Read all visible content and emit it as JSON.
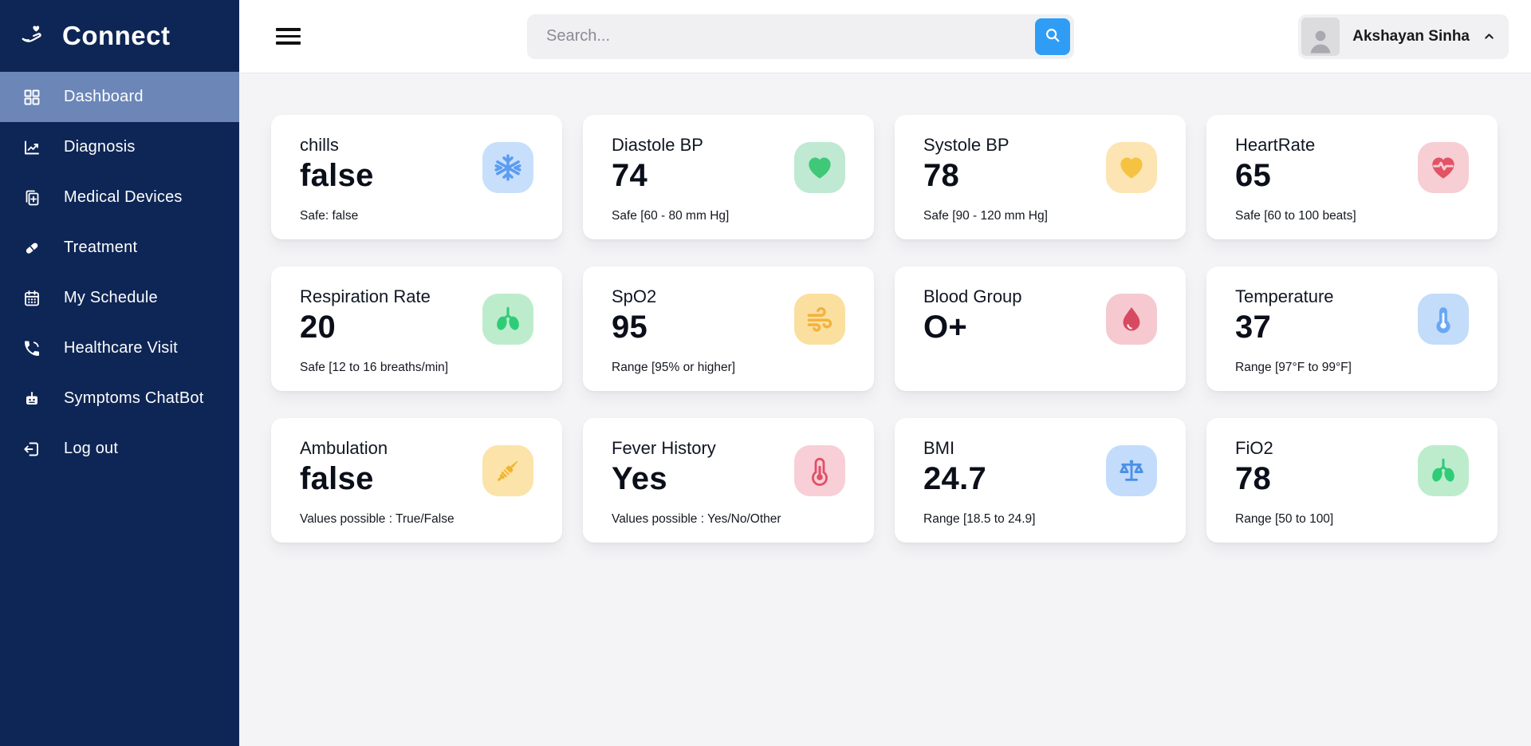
{
  "app": {
    "name": "Connect"
  },
  "theme": {
    "sidebar_bg": "#0e2655",
    "sidebar_active_bg": "#6b86b7",
    "page_bg": "#f4f4f6",
    "topbar_bg": "#ffffff",
    "search_button_blue": "#2f9df5"
  },
  "sidebar": {
    "items": [
      {
        "label": "Dashboard",
        "icon": "dashboard-grid-icon",
        "active": true
      },
      {
        "label": "Diagnosis",
        "icon": "chart-line-icon",
        "active": false
      },
      {
        "label": "Medical Devices",
        "icon": "medical-devices-icon",
        "active": false
      },
      {
        "label": "Treatment",
        "icon": "pill-icon",
        "active": false
      },
      {
        "label": "My Schedule",
        "icon": "calendar-icon",
        "active": false
      },
      {
        "label": "Healthcare Visit",
        "icon": "phone-icon",
        "active": false
      },
      {
        "label": "Symptoms ChatBot",
        "icon": "robot-icon",
        "active": false
      },
      {
        "label": "Log out",
        "icon": "logout-icon",
        "active": false
      }
    ]
  },
  "topbar": {
    "search": {
      "placeholder": "Search...",
      "button_icon": "magnifier-icon"
    },
    "user": {
      "name": "Akshayan Sinha",
      "avatar": "person-placeholder",
      "chevron": "chevron-up-icon"
    }
  },
  "cards": [
    {
      "title": "chills",
      "value": "false",
      "note": "Safe: false",
      "icon": "snowflake-icon",
      "icon_color": "#5b9cf0",
      "icon_bg": "#c7dffb"
    },
    {
      "title": "Diastole BP",
      "value": "74",
      "note": "Safe [60 - 80 mm Hg]",
      "icon": "heart-icon",
      "icon_color": "#3ec878",
      "icon_bg": "#bfe9d2"
    },
    {
      "title": "Systole BP",
      "value": "78",
      "note": "Safe [90 - 120 mm Hg]",
      "icon": "heart-icon",
      "icon_color": "#f6c242",
      "icon_bg": "#fce5b2"
    },
    {
      "title": "HeartRate",
      "value": "65",
      "note": "Safe [60 to 100 beats]",
      "icon": "heart-pulse-icon",
      "icon_color": "#e25365",
      "icon_bg": "#f7ced4"
    },
    {
      "title": "Respiration Rate",
      "value": "20",
      "note": "Safe [12 to 16 breaths/min]",
      "icon": "lungs-icon",
      "icon_color": "#2fcc78",
      "icon_bg": "#bdeccd"
    },
    {
      "title": "SpO2",
      "value": "95",
      "note": "Range [95% or higher]",
      "icon": "wind-icon",
      "icon_color": "#f2b23e",
      "icon_bg": "#fbdf9e"
    },
    {
      "title": "Blood Group",
      "value": "O+",
      "note": "",
      "icon": "blood-drop-icon",
      "icon_color": "#d84a61",
      "icon_bg": "#f6c9d0"
    },
    {
      "title": "Temperature",
      "value": "37",
      "note": "Range [97°F to 99°F]",
      "icon": "thermometer-icon",
      "icon_color": "#68a8f4",
      "icon_bg": "#c2dcfa"
    },
    {
      "title": "Ambulation",
      "value": "false",
      "note": "Values possible : True/False",
      "icon": "syringe-icon",
      "icon_color": "#f2b330",
      "icon_bg": "#fbe3a9"
    },
    {
      "title": "Fever History",
      "value": "Yes",
      "note": "Values possible : Yes/No/Other",
      "icon": "thermometer-icon",
      "icon_color": "#e05168",
      "icon_bg": "#f8cfd6"
    },
    {
      "title": "BMI",
      "value": "24.7",
      "note": "Range [18.5 to 24.9]",
      "icon": "scales-icon",
      "icon_color": "#4a90e8",
      "icon_bg": "#c3dcfb"
    },
    {
      "title": "FiO2",
      "value": "78",
      "note": "Range [50 to 100]",
      "icon": "lungs-icon",
      "icon_color": "#2fcc78",
      "icon_bg": "#bdeccd"
    }
  ]
}
